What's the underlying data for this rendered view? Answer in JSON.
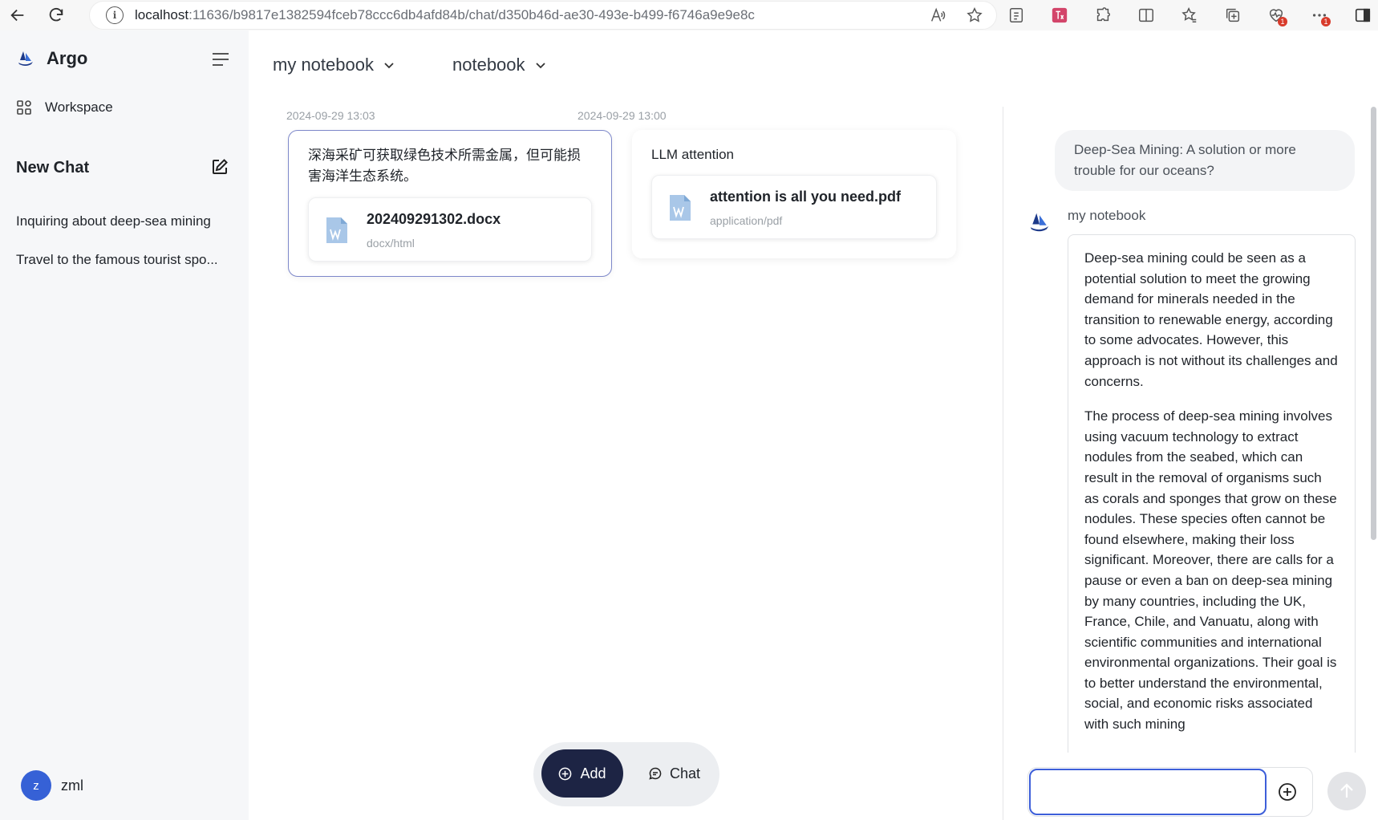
{
  "browser": {
    "url_host": "localhost",
    "url_path": ":11636/b9817e1382594fceb78ccc6db4afd84b/chat/d350b46d-ae30-493e-b499-f6746a9e9e8c",
    "badge_count_1": "1",
    "badge_count_2": "1"
  },
  "sidebar": {
    "brand": "Argo",
    "workspace_label": "Workspace",
    "new_chat_label": "New Chat",
    "history": [
      "Inquiring about deep-sea mining",
      "Travel to the famous tourist spo..."
    ],
    "user": {
      "initial": "z",
      "name": "zml"
    }
  },
  "main": {
    "dropdown_1": "my notebook",
    "dropdown_2": "notebook",
    "cards": [
      {
        "date": "2024-09-29 13:03",
        "title": "深海采矿可获取绿色技术所需金属，但可能损害海洋生态系统。",
        "file_name": "202409291302.docx",
        "file_type": "docx/html"
      },
      {
        "date": "2024-09-29 13:00",
        "title": "LLM attention",
        "file_name": "attention is all you need.pdf",
        "file_type": "application/pdf"
      }
    ],
    "add_label": "Add",
    "chat_label": "Chat"
  },
  "chat": {
    "user_message": "Deep-Sea Mining: A solution or more trouble for our oceans?",
    "bot_name": "my notebook",
    "reply_paragraphs": [
      "Deep-sea mining could be seen as a potential solution to meet the growing demand for minerals needed in the transition to renewable energy, according to some advocates. However, this approach is not without its challenges and concerns.",
      "The process of deep-sea mining involves using vacuum technology to extract nodules from the seabed, which can result in the removal of organisms such as corals and sponges that grow on these nodules. These species often cannot be found elsewhere, making their loss significant. Moreover, there are calls for a pause or even a ban on deep-sea mining by many countries, including the UK, France, Chile, and Vanuatu, along with scientific communities and international environmental organizations. Their goal is to better understand the environmental, social, and economic risks associated with such mining"
    ],
    "input_value": ""
  },
  "colors": {
    "accent": "#3d5fd9",
    "add_button": "#1d2444",
    "avatar": "#3661d6",
    "card_selected_border": "#7d87c9",
    "sidebar_bg": "#f6f7f9"
  },
  "icons": [
    "back-arrow-icon",
    "reload-icon",
    "info-icon",
    "read-aloud-icon",
    "favorite-star-icon",
    "menu-icon",
    "workspace-grid-icon",
    "edit-icon",
    "chevron-down-icon",
    "word-file-icon",
    "plus-circle-icon",
    "chat-bubble-icon",
    "arrow-up-icon"
  ]
}
